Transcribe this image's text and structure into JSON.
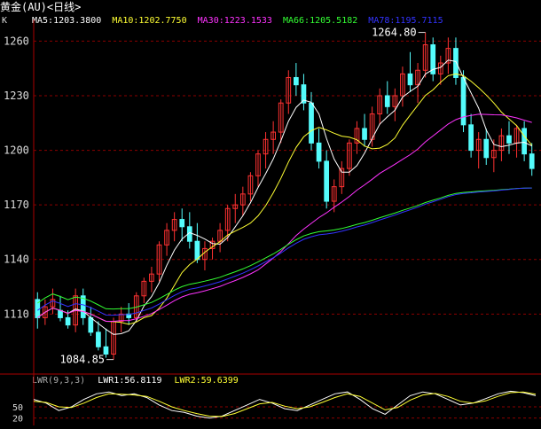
{
  "window": {
    "title": "黄金(AU)<日线>"
  },
  "legend": {
    "k_label": "K",
    "ma": [
      {
        "label": "MA5:1203.3800",
        "color": "#ffffff"
      },
      {
        "label": "MA10:1202.7750",
        "color": "#ffff33"
      },
      {
        "label": "MA30:1223.1533",
        "color": "#ff33ff"
      },
      {
        "label": "MA66:1205.5182",
        "color": "#33ff33"
      },
      {
        "label": "MA78:1195.7115",
        "color": "#3333ff"
      }
    ]
  },
  "lwr_legend": [
    {
      "label": "LWR(9,3,3)",
      "color": "#aaaaaa"
    },
    {
      "label": "LWR1:56.8119",
      "color": "#ffffff"
    },
    {
      "label": "LWR2:59.6399",
      "color": "#ffff33"
    }
  ],
  "annotations": {
    "high": "1264.80",
    "low": "1084.85"
  },
  "colors": {
    "up": "#ff3232",
    "down": "#54fcfc",
    "grid": "#8b0000",
    "axis": "#aa0000"
  },
  "chart_data": [
    {
      "type": "candlestick",
      "yticks": [
        "1260",
        "1230",
        "1200",
        "1170",
        "1140",
        "1110"
      ],
      "ylim": [
        1078,
        1268
      ],
      "grid": true,
      "candles_ohlc": [
        [
          1118,
          1122,
          1102,
          1108
        ],
        [
          1108,
          1118,
          1104,
          1114
        ],
        [
          1114,
          1124,
          1110,
          1118
        ],
        [
          1112,
          1120,
          1106,
          1108
        ],
        [
          1108,
          1112,
          1102,
          1104
        ],
        [
          1104,
          1124,
          1100,
          1120
        ],
        [
          1120,
          1124,
          1104,
          1108
        ],
        [
          1108,
          1114,
          1098,
          1100
        ],
        [
          1100,
          1106,
          1090,
          1092
        ],
        [
          1092,
          1102,
          1086,
          1088
        ],
        [
          1088,
          1108,
          1085,
          1106
        ],
        [
          1106,
          1114,
          1100,
          1110
        ],
        [
          1110,
          1116,
          1104,
          1108
        ],
        [
          1108,
          1122,
          1106,
          1120
        ],
        [
          1120,
          1130,
          1116,
          1128
        ],
        [
          1128,
          1136,
          1122,
          1132
        ],
        [
          1132,
          1150,
          1128,
          1148
        ],
        [
          1148,
          1160,
          1142,
          1156
        ],
        [
          1156,
          1166,
          1150,
          1162
        ],
        [
          1162,
          1168,
          1150,
          1158
        ],
        [
          1158,
          1166,
          1146,
          1150
        ],
        [
          1150,
          1160,
          1138,
          1140
        ],
        [
          1140,
          1150,
          1134,
          1146
        ],
        [
          1146,
          1152,
          1140,
          1150
        ],
        [
          1150,
          1160,
          1144,
          1156
        ],
        [
          1156,
          1170,
          1150,
          1168
        ],
        [
          1168,
          1176,
          1160,
          1170
        ],
        [
          1170,
          1180,
          1164,
          1176
        ],
        [
          1176,
          1188,
          1172,
          1186
        ],
        [
          1186,
          1200,
          1180,
          1198
        ],
        [
          1198,
          1210,
          1190,
          1206
        ],
        [
          1206,
          1216,
          1198,
          1210
        ],
        [
          1210,
          1228,
          1204,
          1226
        ],
        [
          1226,
          1244,
          1220,
          1240
        ],
        [
          1240,
          1248,
          1230,
          1236
        ],
        [
          1236,
          1242,
          1222,
          1226
        ],
        [
          1226,
          1232,
          1200,
          1204
        ],
        [
          1204,
          1212,
          1190,
          1194
        ],
        [
          1194,
          1200,
          1168,
          1172
        ],
        [
          1172,
          1184,
          1166,
          1180
        ],
        [
          1180,
          1194,
          1176,
          1190
        ],
        [
          1190,
          1206,
          1186,
          1204
        ],
        [
          1204,
          1216,
          1198,
          1212
        ],
        [
          1212,
          1220,
          1202,
          1206
        ],
        [
          1206,
          1224,
          1202,
          1220
        ],
        [
          1220,
          1234,
          1214,
          1230
        ],
        [
          1230,
          1238,
          1220,
          1224
        ],
        [
          1224,
          1234,
          1216,
          1230
        ],
        [
          1230,
          1246,
          1224,
          1242
        ],
        [
          1242,
          1254,
          1232,
          1236
        ],
        [
          1236,
          1248,
          1226,
          1244
        ],
        [
          1244,
          1264.8,
          1240,
          1258
        ],
        [
          1258,
          1262,
          1238,
          1242
        ],
        [
          1242,
          1252,
          1236,
          1248
        ],
        [
          1248,
          1262,
          1242,
          1256
        ],
        [
          1256,
          1262,
          1236,
          1240
        ],
        [
          1240,
          1244,
          1210,
          1214
        ],
        [
          1214,
          1220,
          1196,
          1200
        ],
        [
          1200,
          1210,
          1190,
          1206
        ],
        [
          1206,
          1212,
          1192,
          1196
        ],
        [
          1196,
          1206,
          1188,
          1200
        ],
        [
          1200,
          1212,
          1194,
          1208
        ],
        [
          1208,
          1216,
          1198,
          1204
        ],
        [
          1204,
          1214,
          1196,
          1212
        ],
        [
          1212,
          1216,
          1194,
          1198
        ],
        [
          1198,
          1204,
          1186,
          1190
        ]
      ]
    },
    {
      "type": "line",
      "name": "LWR",
      "yticks": [
        "50",
        "20"
      ],
      "ylim": [
        0,
        100
      ],
      "series": [
        {
          "name": "LWR1",
          "values": [
            70,
            60,
            40,
            50,
            70,
            85,
            90,
            80,
            85,
            75,
            55,
            40,
            35,
            25,
            20,
            25,
            40,
            55,
            70,
            60,
            45,
            40,
            55,
            70,
            85,
            90,
            70,
            45,
            30,
            55,
            80,
            90,
            85,
            70,
            55,
            60,
            72,
            85,
            92,
            88,
            80
          ]
        },
        {
          "name": "LWR2",
          "values": [
            65,
            62,
            50,
            48,
            60,
            75,
            85,
            84,
            82,
            78,
            65,
            50,
            40,
            32,
            25,
            24,
            32,
            45,
            58,
            62,
            52,
            45,
            50,
            62,
            75,
            85,
            78,
            60,
            42,
            48,
            68,
            82,
            86,
            78,
            65,
            60,
            66,
            78,
            88,
            90,
            84
          ]
        }
      ]
    }
  ]
}
